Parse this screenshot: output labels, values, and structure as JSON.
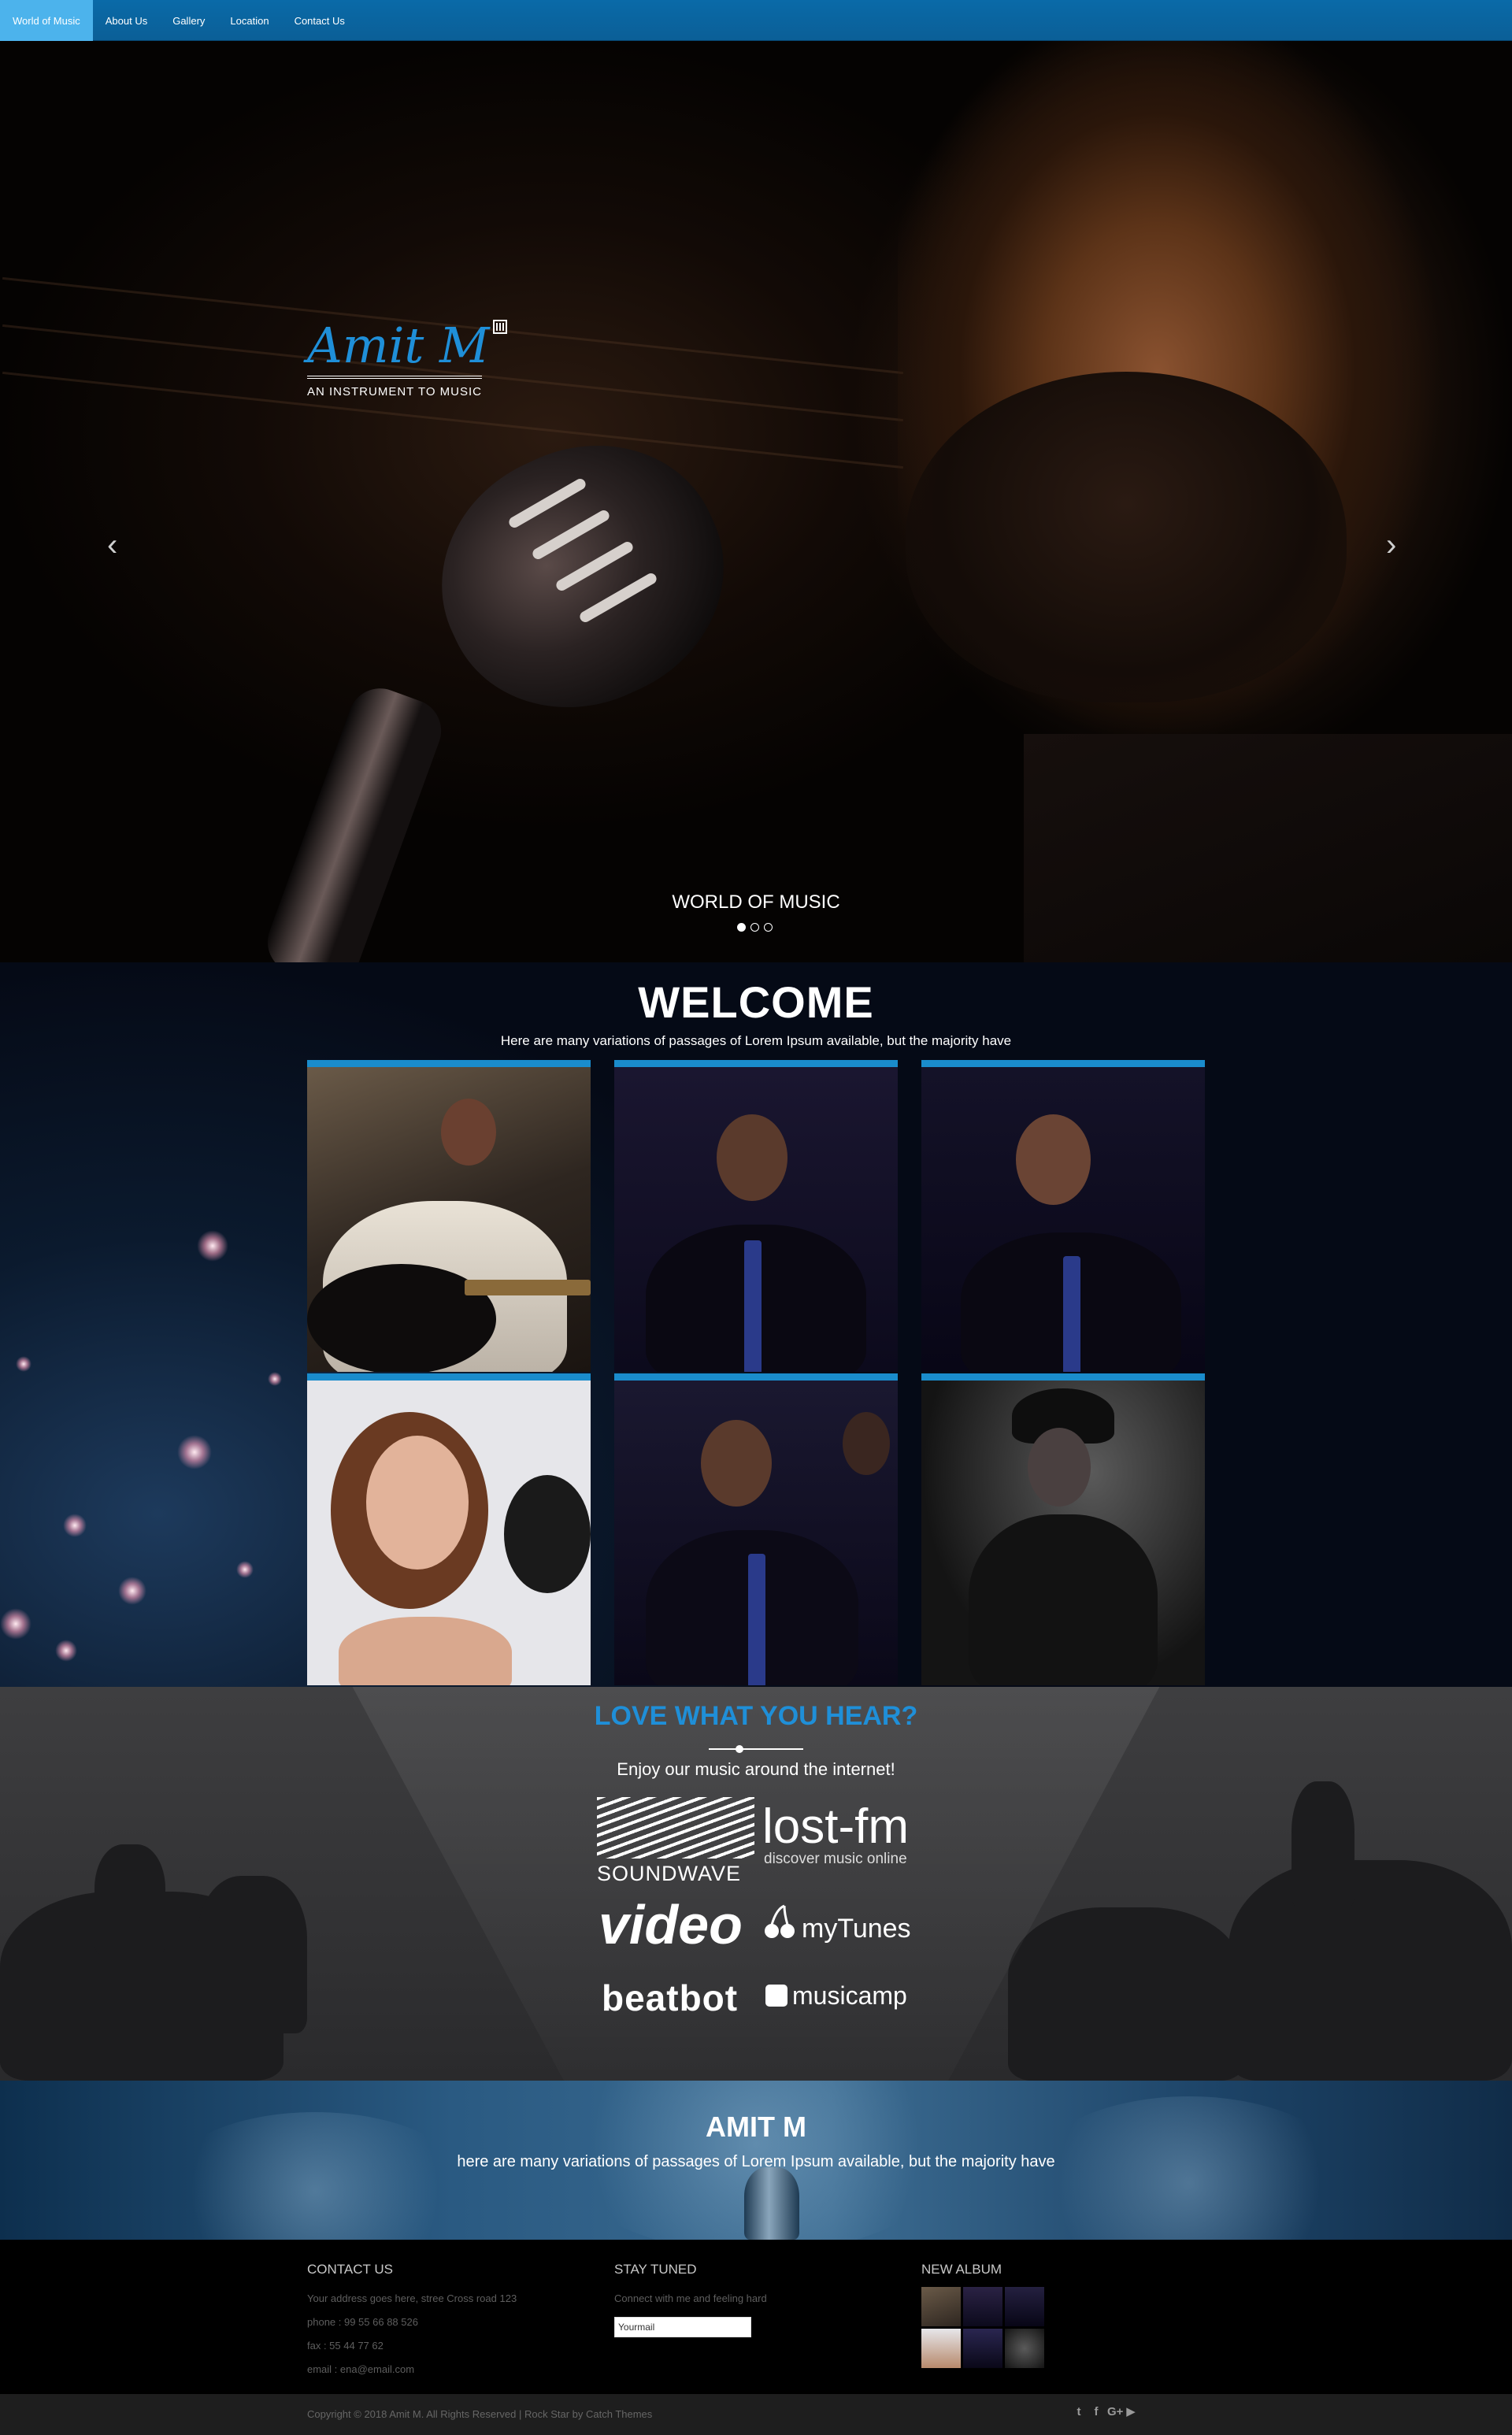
{
  "nav": {
    "items": [
      {
        "label": "World of Music",
        "active": true
      },
      {
        "label": "About Us"
      },
      {
        "label": "Gallery"
      },
      {
        "label": "Location"
      },
      {
        "label": "Contact Us"
      }
    ],
    "accent_color": "#0b63a0",
    "active_color": "#4cb3ec"
  },
  "hero": {
    "logo_name": "Amit M",
    "logo_tagline": "AN INSTRUMENT TO MUSIC",
    "caption": "WORLD OF MUSIC",
    "prev_icon": "chevron-left-icon",
    "next_icon": "chevron-right-icon",
    "prev_glyph": "‹",
    "next_glyph": "›",
    "slide_count": 3,
    "active_slide": 1
  },
  "welcome": {
    "title": "WELCOME",
    "subtitle": "Here are many variations of passages of Lorem Ipsum available, but the majority have",
    "tile_border_color": "#1a8ccc"
  },
  "love": {
    "title": "LOVE WHAT YOU HEAR?",
    "subtitle": "Enjoy our music around the internet!",
    "title_color": "#1f8fd8",
    "brands": {
      "soundwave": "SOUNDWAVE",
      "lostfm": "lost-fm",
      "lostfm_sub": "discover music online",
      "video": "video",
      "mytunes": "myTunes",
      "beatbot": "beatbot",
      "musicamp": "musicamp"
    }
  },
  "band": {
    "title": "AMIT M",
    "subtitle": "here are many variations of passages of Lorem Ipsum available, but the majority have"
  },
  "footer": {
    "contact": {
      "heading": "CONTACT US",
      "address": "Your address goes here, stree Cross road 123",
      "phone": "phone : 99 55 66 88 526",
      "fax": "fax : 55 44 77 62",
      "email": "email : ena@email.com"
    },
    "stay": {
      "heading": "STAY TUNED",
      "text": "Connect with me and feeling hard",
      "input_value": "Yourmail"
    },
    "album": {
      "heading": "NEW ALBUM"
    },
    "copyright": "Copyright © 2018 Amit M. All Rights Reserved | Rock Star by Catch Themes",
    "social": [
      {
        "icon": "twitter-icon",
        "glyph": "t"
      },
      {
        "icon": "facebook-icon",
        "glyph": "f"
      },
      {
        "icon": "google-plus-icon",
        "glyph": "G+"
      },
      {
        "icon": "youtube-icon",
        "glyph": "▶"
      }
    ]
  }
}
